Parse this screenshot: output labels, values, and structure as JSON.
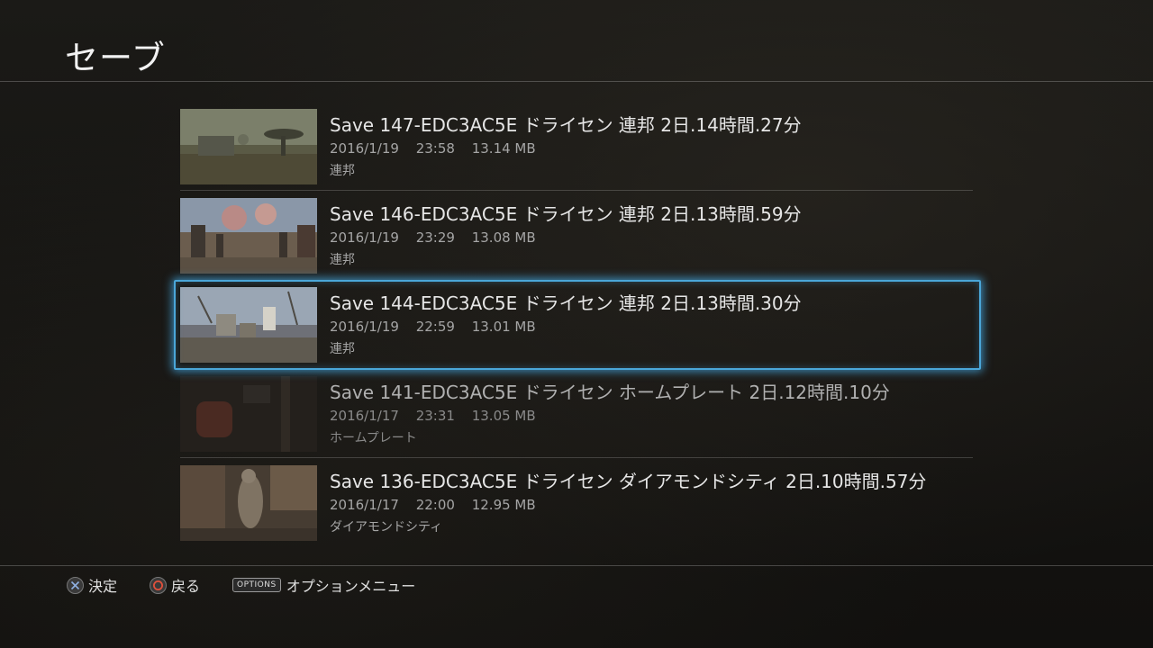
{
  "header": {
    "title": "セーブ"
  },
  "saves": [
    {
      "title": "Save 147-EDC3AC5E ドライセン 連邦 2日.14時間.27分",
      "date": "2016/1/19",
      "time": "23:58",
      "size": "13.14 MB",
      "location": "連邦"
    },
    {
      "title": "Save 146-EDC3AC5E ドライセン 連邦 2日.13時間.59分",
      "date": "2016/1/19",
      "time": "23:29",
      "size": "13.08 MB",
      "location": "連邦"
    },
    {
      "title": "Save 144-EDC3AC5E ドライセン 連邦 2日.13時間.30分",
      "date": "2016/1/19",
      "time": "22:59",
      "size": "13.01 MB",
      "location": "連邦"
    },
    {
      "title": "Save 141-EDC3AC5E ドライセン ホームプレート 2日.12時間.10分",
      "date": "2016/1/17",
      "time": "23:31",
      "size": "13.05 MB",
      "location": "ホームプレート"
    },
    {
      "title": "Save 136-EDC3AC5E ドライセン ダイアモンドシティ 2日.10時間.57分",
      "date": "2016/1/17",
      "time": "22:00",
      "size": "12.95 MB",
      "location": "ダイアモンドシティ"
    }
  ],
  "footer": {
    "confirm": {
      "icon": "cross-button-icon",
      "label": "決定"
    },
    "back": {
      "icon": "circle-button-icon",
      "label": "戻る"
    },
    "options": {
      "icon_text": "OPTIONS",
      "label": "オプションメニュー"
    }
  },
  "colors": {
    "focus_border": "#4aa6d8",
    "cross_icon": "#8fb0e0",
    "circle_icon": "#e0503c"
  }
}
